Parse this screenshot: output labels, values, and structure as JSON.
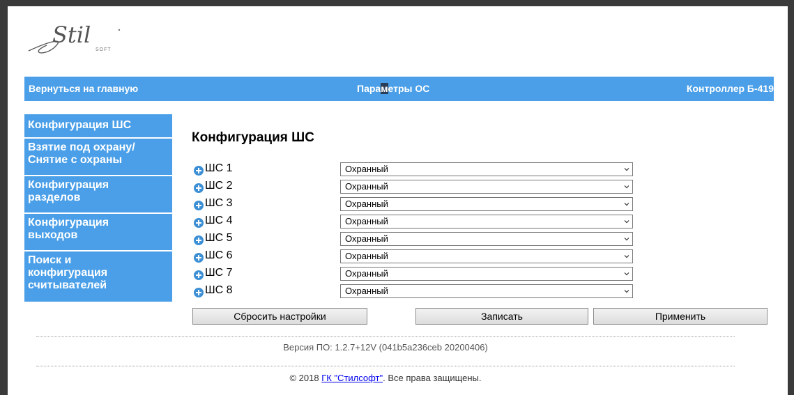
{
  "header": {
    "back_link": "Вернуться на главную",
    "title_part1": "Пара",
    "title_highlight": "м",
    "title_part2": "етры ОС",
    "device": "Контроллер Б-419"
  },
  "logo": {
    "text": "Stil",
    "subtext": "SOFT"
  },
  "sidebar": {
    "items": [
      {
        "line1": "Конфигурация ШС",
        "line2": "",
        "line3": ""
      },
      {
        "line1": "Взятие под охрану/",
        "line2": "Снятие с охраны",
        "line3": ""
      },
      {
        "line1": "Конфигурация",
        "line2": "разделов",
        "line3": ""
      },
      {
        "line1": "Конфигурация",
        "line2": "выходов",
        "line3": ""
      },
      {
        "line1": "Поиск и",
        "line2": "конфигурация",
        "line3": "считывателей"
      }
    ]
  },
  "main": {
    "title": "Конфигурация ШС",
    "loops": [
      {
        "label": "ШС 1",
        "value": "Охранный"
      },
      {
        "label": "ШС 2",
        "value": "Охранный"
      },
      {
        "label": "ШС 3",
        "value": "Охранный"
      },
      {
        "label": "ШС 4",
        "value": "Охранный"
      },
      {
        "label": "ШС 5",
        "value": "Охранный"
      },
      {
        "label": "ШС 6",
        "value": "Охранный"
      },
      {
        "label": "ШС 7",
        "value": "Охранный"
      },
      {
        "label": "ШС 8",
        "value": "Охранный"
      }
    ]
  },
  "buttons": {
    "reset": "Сбросить настройки",
    "write": "Записать",
    "apply": "Применить"
  },
  "footer": {
    "version": "Версия ПО: 1.2.7+12V (041b5a236ceb 20200406)",
    "copyright_prefix": "© 2018 ",
    "company_link": "ГК \"Стилсофт\"",
    "copyright_suffix": ". Все права защищены."
  },
  "colors": {
    "accent": "#4a9fe8",
    "frame": "#3a3a3a"
  }
}
